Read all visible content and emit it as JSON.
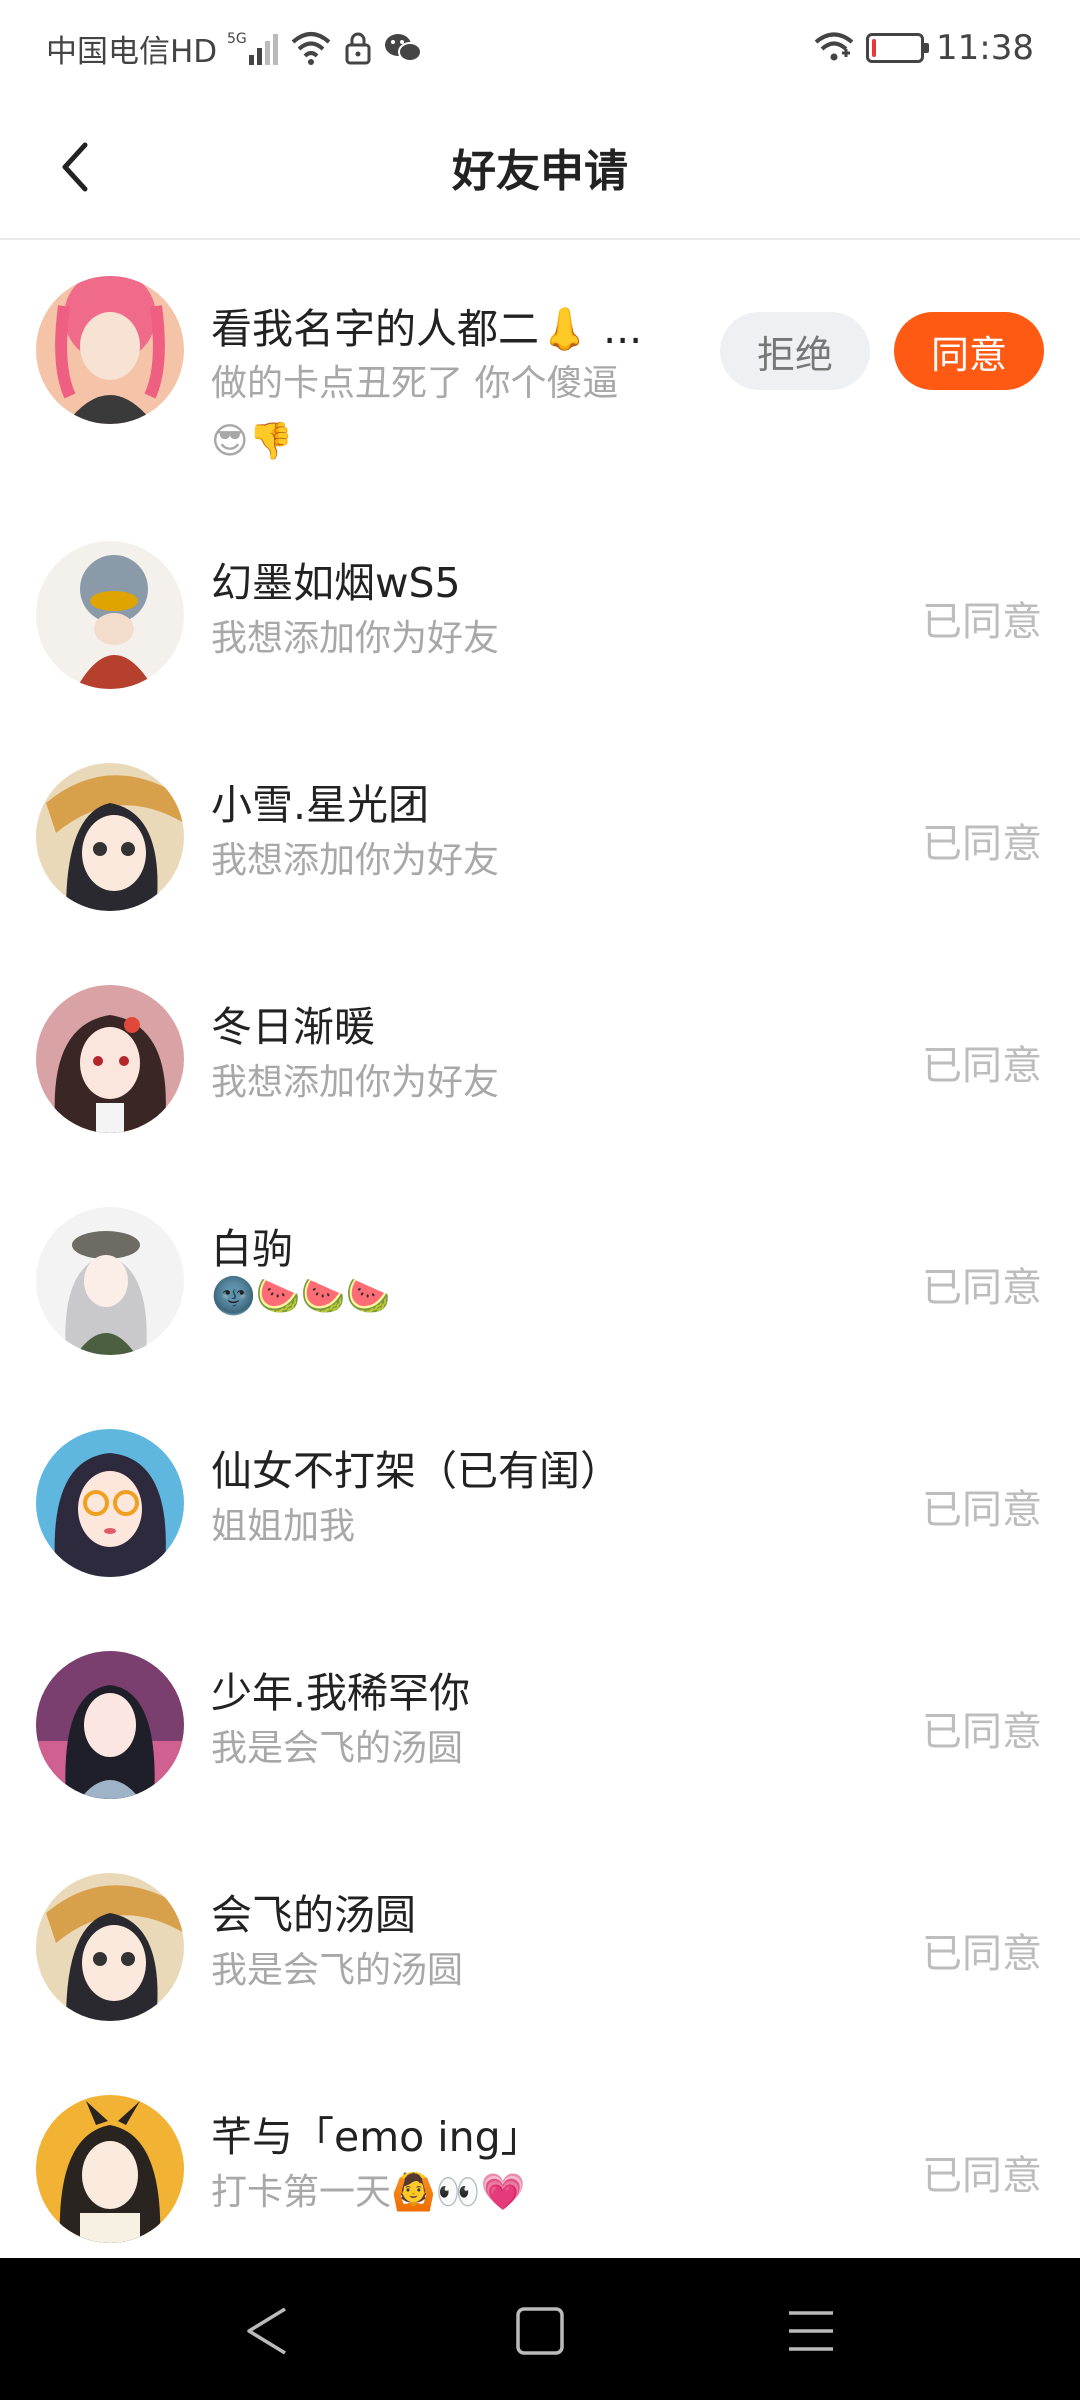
{
  "status_bar": {
    "carrier": "中国电信HD",
    "network": "5G",
    "time": "11:38",
    "battery_level": 0.08
  },
  "header": {
    "title": "好友申请",
    "back_icon": "chevron-left-icon"
  },
  "requests": [
    {
      "name": "看我名字的人都二👃 ...",
      "message": "做的卡点丑死了 你个傻逼",
      "message_extra": "😎👎",
      "reject_label": "拒绝",
      "accept_label": "同意",
      "pending": true
    },
    {
      "name": "幻墨如烟wS5",
      "message": "我想添加你为好友",
      "status": "已同意"
    },
    {
      "name": "小雪.星光团",
      "message": "我想添加你为好友",
      "status": "已同意"
    },
    {
      "name": "冬日渐暖",
      "message": "我想添加你为好友",
      "status": "已同意"
    },
    {
      "name": "白驹",
      "message": "🌚🍉🍉🍉",
      "status": "已同意"
    },
    {
      "name": "仙女不打架（已有闺）",
      "message": "姐姐加我",
      "status": "已同意"
    },
    {
      "name": "少年.我稀罕你",
      "message": "我是会飞的汤圆",
      "status": "已同意"
    },
    {
      "name": "会飞的汤圆",
      "message": "我是会飞的汤圆",
      "status": "已同意"
    },
    {
      "name": "芊与「emo ing」",
      "message": "打卡第一天🙆👀💗",
      "status": "已同意"
    }
  ],
  "nav_bar": {
    "back_icon": "triangle-back-icon",
    "home_icon": "square-home-icon",
    "menu_icon": "menu-lines-icon"
  },
  "colors": {
    "accent": "#ff5a14",
    "reject_bg": "#eef0f4",
    "status_text": "#bdbdbd"
  }
}
